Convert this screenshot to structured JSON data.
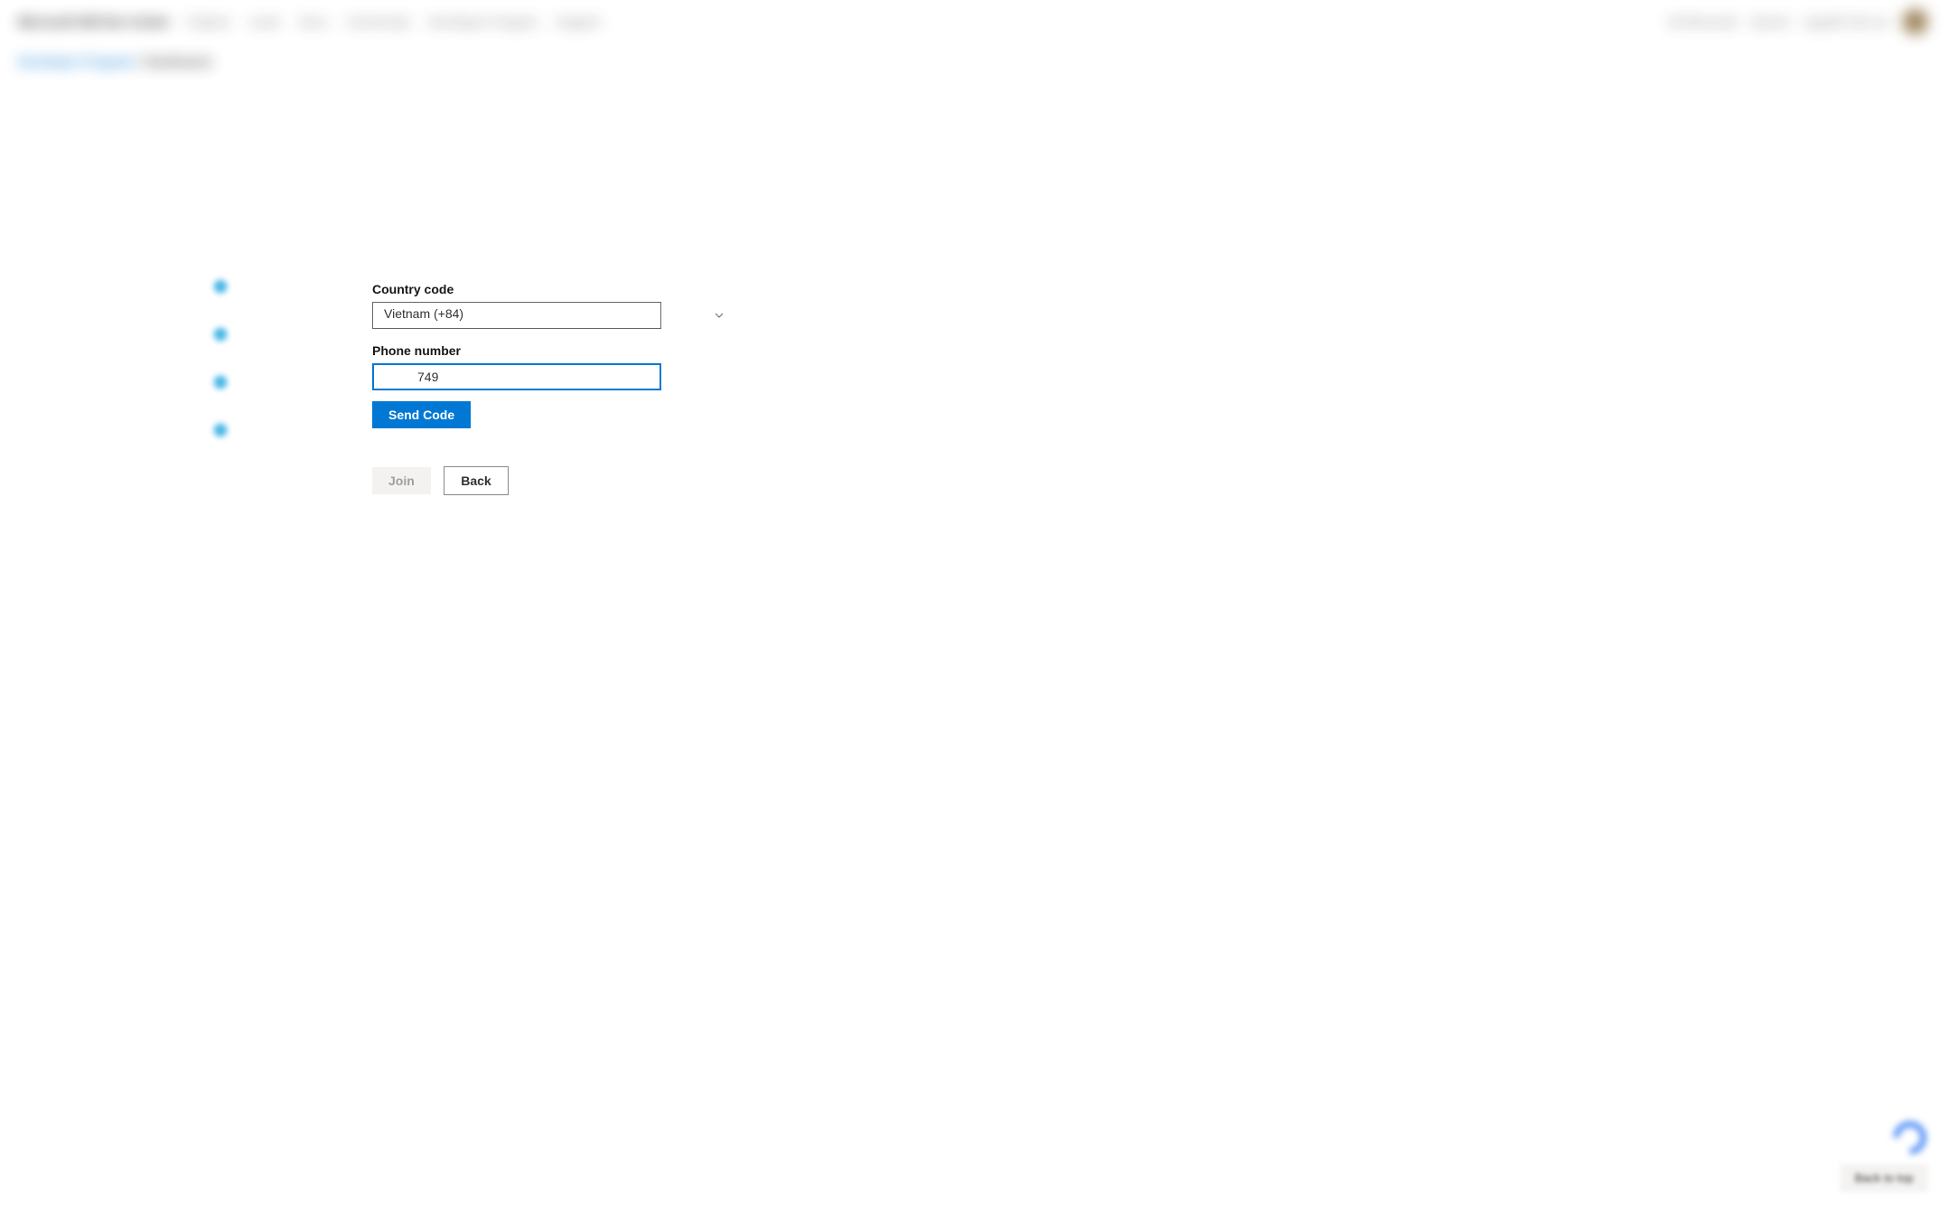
{
  "header": {
    "brand": "Microsoft 365 Dev Center",
    "nav_items": [
      "Explore",
      "Learn",
      "Docs",
      "Community",
      "Developer Program",
      "Support"
    ],
    "all_microsoft": "All Microsoft",
    "search": "Search",
    "user_name": "nguyễn hữu an"
  },
  "breadcrumb": {
    "link": "Developer Program",
    "current": "Dashboard"
  },
  "form": {
    "country_code_label": "Country code",
    "country_code_value": "Vietnam (+84)",
    "phone_label": "Phone number",
    "phone_value": "749",
    "send_code_label": "Send Code",
    "join_label": "Join",
    "back_label": "Back"
  },
  "footer": {
    "back_to_top": "Back to top"
  },
  "colors": {
    "primary": "#0078d4",
    "link": "#0078d4"
  }
}
